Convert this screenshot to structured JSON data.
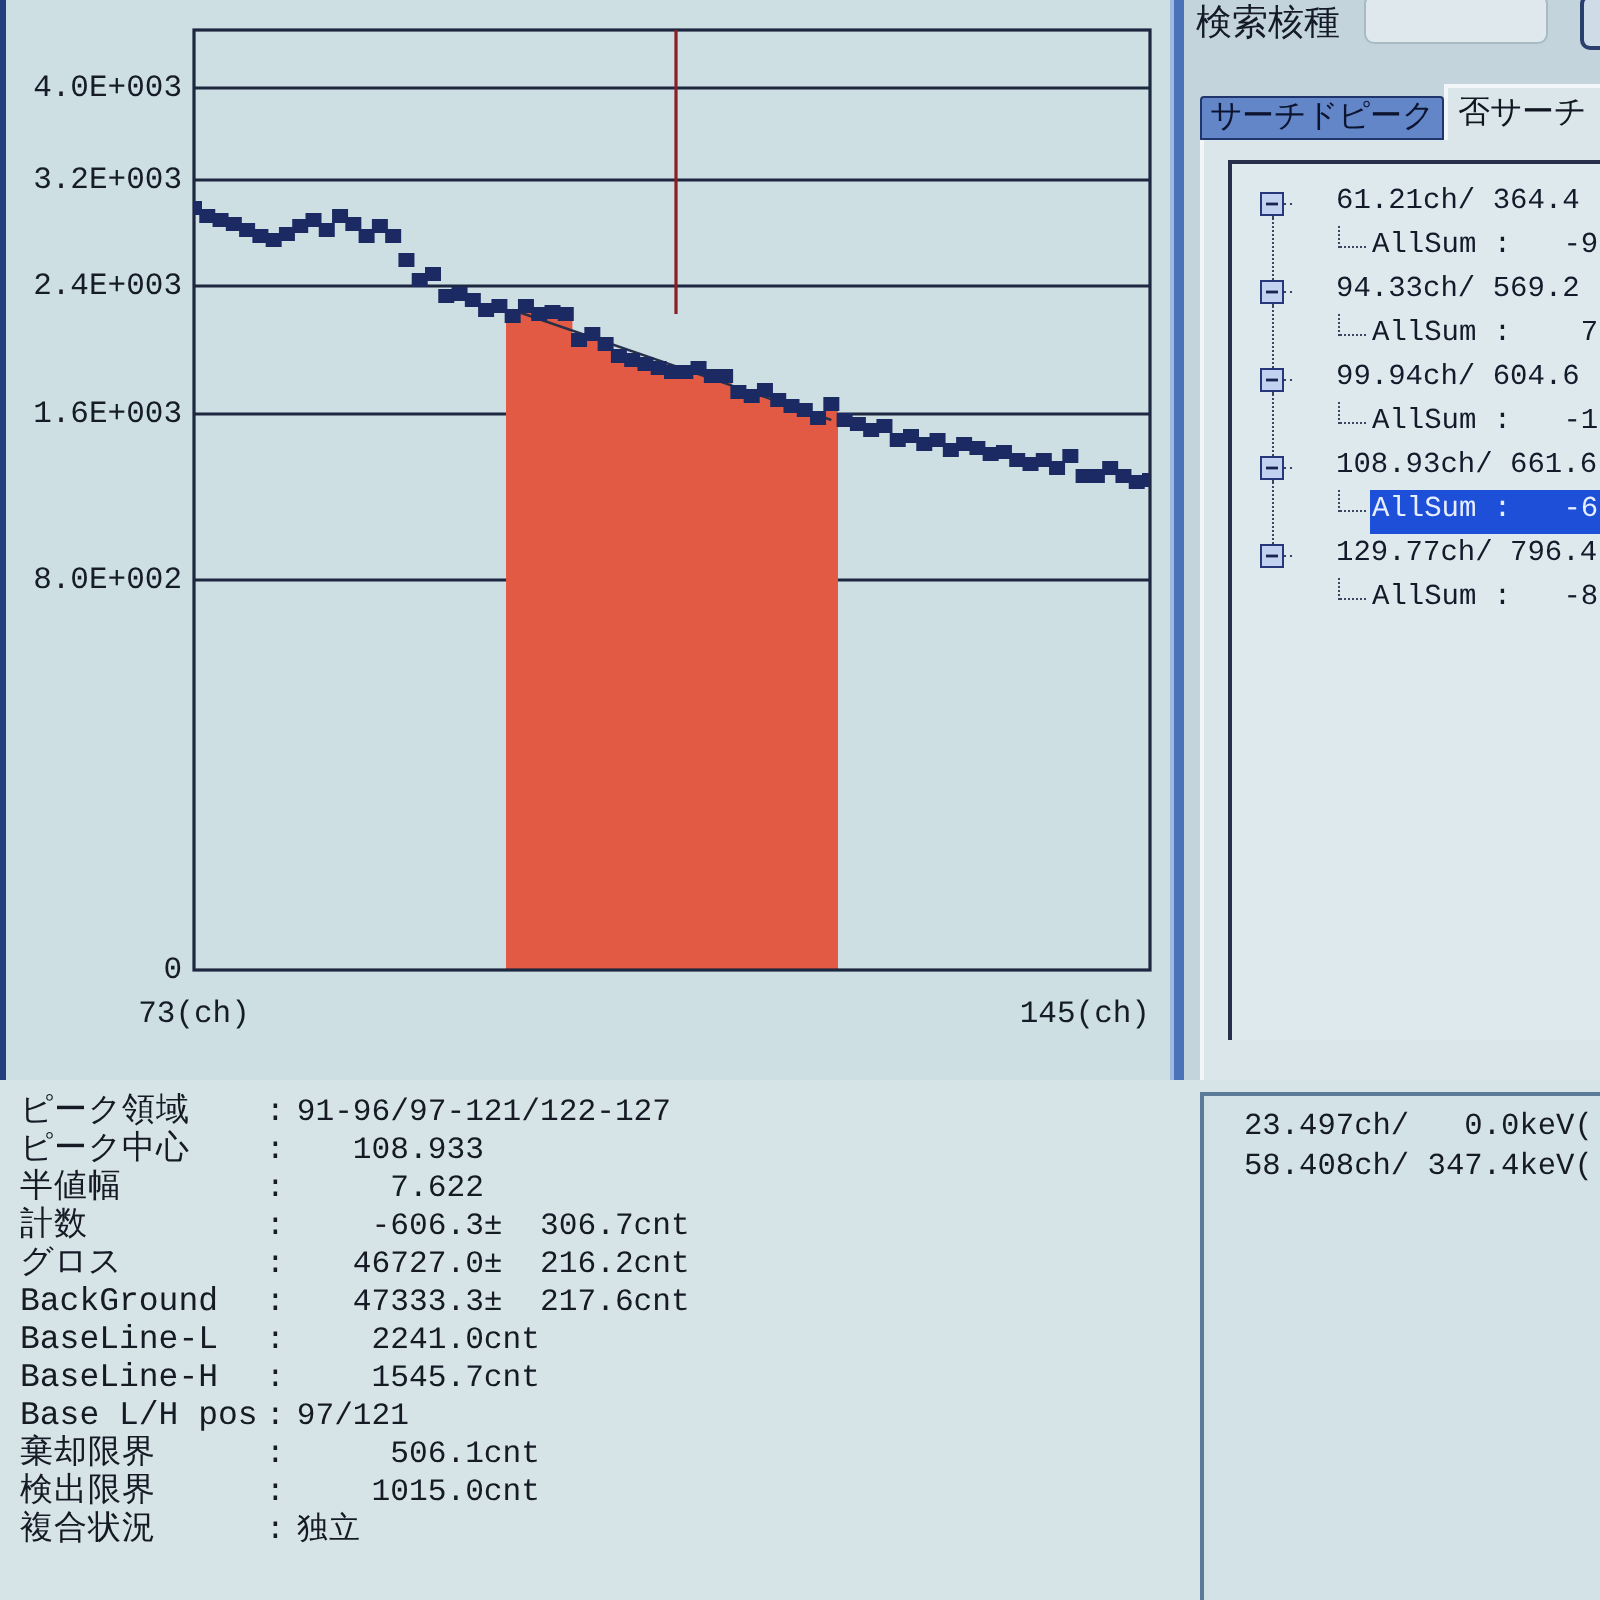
{
  "chart": {
    "y_labels": [
      "4.0E+003",
      "3.2E+003",
      "2.4E+003",
      "1.6E+003",
      "8.0E+002",
      "0"
    ],
    "x_labels": [
      "73(ch)",
      "145(ch)"
    ]
  },
  "search": {
    "label": "検索核種"
  },
  "tabs": [
    {
      "label": "サーチドピーク",
      "selected": false
    },
    {
      "label": "否サーチ",
      "selected": true
    }
  ],
  "tree": {
    "nodes": [
      {
        "label": "61.21ch/ 364.4",
        "expanded": true,
        "selected": false,
        "children": [
          {
            "label": "AllSum :   -9",
            "selected": false
          }
        ]
      },
      {
        "label": "94.33ch/ 569.2",
        "expanded": true,
        "selected": false,
        "children": [
          {
            "label": "AllSum :    7",
            "selected": false
          }
        ]
      },
      {
        "label": "99.94ch/ 604.6",
        "expanded": true,
        "selected": false,
        "children": [
          {
            "label": "AllSum :   -1",
            "selected": false
          }
        ]
      },
      {
        "label": "108.93ch/ 661.6",
        "expanded": true,
        "selected": false,
        "children": [
          {
            "label": "AllSum :   -6",
            "selected": true
          }
        ]
      },
      {
        "label": "129.77ch/ 796.4",
        "expanded": true,
        "selected": false,
        "children": [
          {
            "label": "AllSum :   -8",
            "selected": false
          }
        ]
      }
    ]
  },
  "properties": [
    {
      "label": "ピーク領域",
      "sep": ":",
      "value": "91-96/97-121/122-127"
    },
    {
      "label": "ピーク中心",
      "sep": ":",
      "value": "   108.933"
    },
    {
      "label": "半値幅",
      "sep": ":",
      "value": "     7.622"
    },
    {
      "label": "計数",
      "sep": ":",
      "value": "    -606.3±  306.7cnt"
    },
    {
      "label": "グロス",
      "sep": ":",
      "value": "   46727.0±  216.2cnt"
    },
    {
      "label": "BackGround",
      "sep": ":",
      "value": "   47333.3±  217.6cnt"
    },
    {
      "label": "BaseLine-L",
      "sep": ":",
      "value": "    2241.0cnt"
    },
    {
      "label": "BaseLine-H",
      "sep": ":",
      "value": "    1545.7cnt"
    },
    {
      "label": "Base L/H pos",
      "sep": ":",
      "value": "97/121"
    },
    {
      "label": "棄却限界",
      "sep": ":",
      "value": "     506.1cnt"
    },
    {
      "label": "検出限界",
      "sep": ":",
      "value": "    1015.0cnt"
    },
    {
      "label": "複合状況",
      "sep": ":",
      "value": "独立"
    }
  ],
  "calibration": [
    "23.497ch/   0.0keV(",
    "58.408ch/ 347.4keV("
  ]
}
